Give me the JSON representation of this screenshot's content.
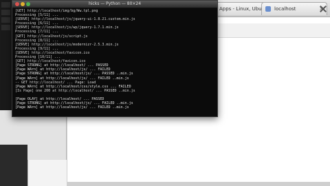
{
  "browser": {
    "tabs": [
      {
        "label": "Apps - Linux, UbuntuNews"
      },
      {
        "label": "localhost"
      }
    ],
    "close_label": "×"
  },
  "terminal": {
    "title": "hicks — Python — 80×24",
    "lines": [
      "[GET] http://localhost/img/bg/Ww.tpl.png",
      "Processing [5/11] ...",
      "[SERVE] http://localhost/js/jquery-ui-1.8.21.custom.min.js",
      "Processing [6/11] ...",
      "[SERVE] http://localhost/js/wp/jquery-1.7.1.min.js",
      "Processing [7/11] ...",
      "[GET] http://localhost/js/script.js",
      "Processing [8/11] ...",
      "[SERVE] http://localhost/js/modernizr-2.5.3.min.js",
      "Processing [9/11] ...",
      "[SERVE] http://localhost/favicon.ico",
      "Processing [10/11] ...",
      "[GET] http://localhost/favicon.ico",
      "[Page STRONG] at http://localhost/ ... PASSED",
      "[Page WArn] at http://localhost/js/ ... FAILED",
      "[Page STRONG] at http://localhost/js/ ... PASSED ..min.js",
      "[Page WArn] at http://localhost/js/ ... FAILED ..min.js",
      "-- GET http://localhost/ ... Page: Load",
      "[Page WArn] at http://localhost/css/style.css ... FAILED",
      "[Is Page] one 200 at http://localhost/ ... PASSED ..min.js",
      "",
      "[Page OLAY] at http://localhost/ ... PASSED",
      "[Page STRONG] at http://localhost/js/ ... FAILED ..min.js",
      "[Page WArn] at http://localhost/js/ ... FAILED ..min.js"
    ]
  }
}
